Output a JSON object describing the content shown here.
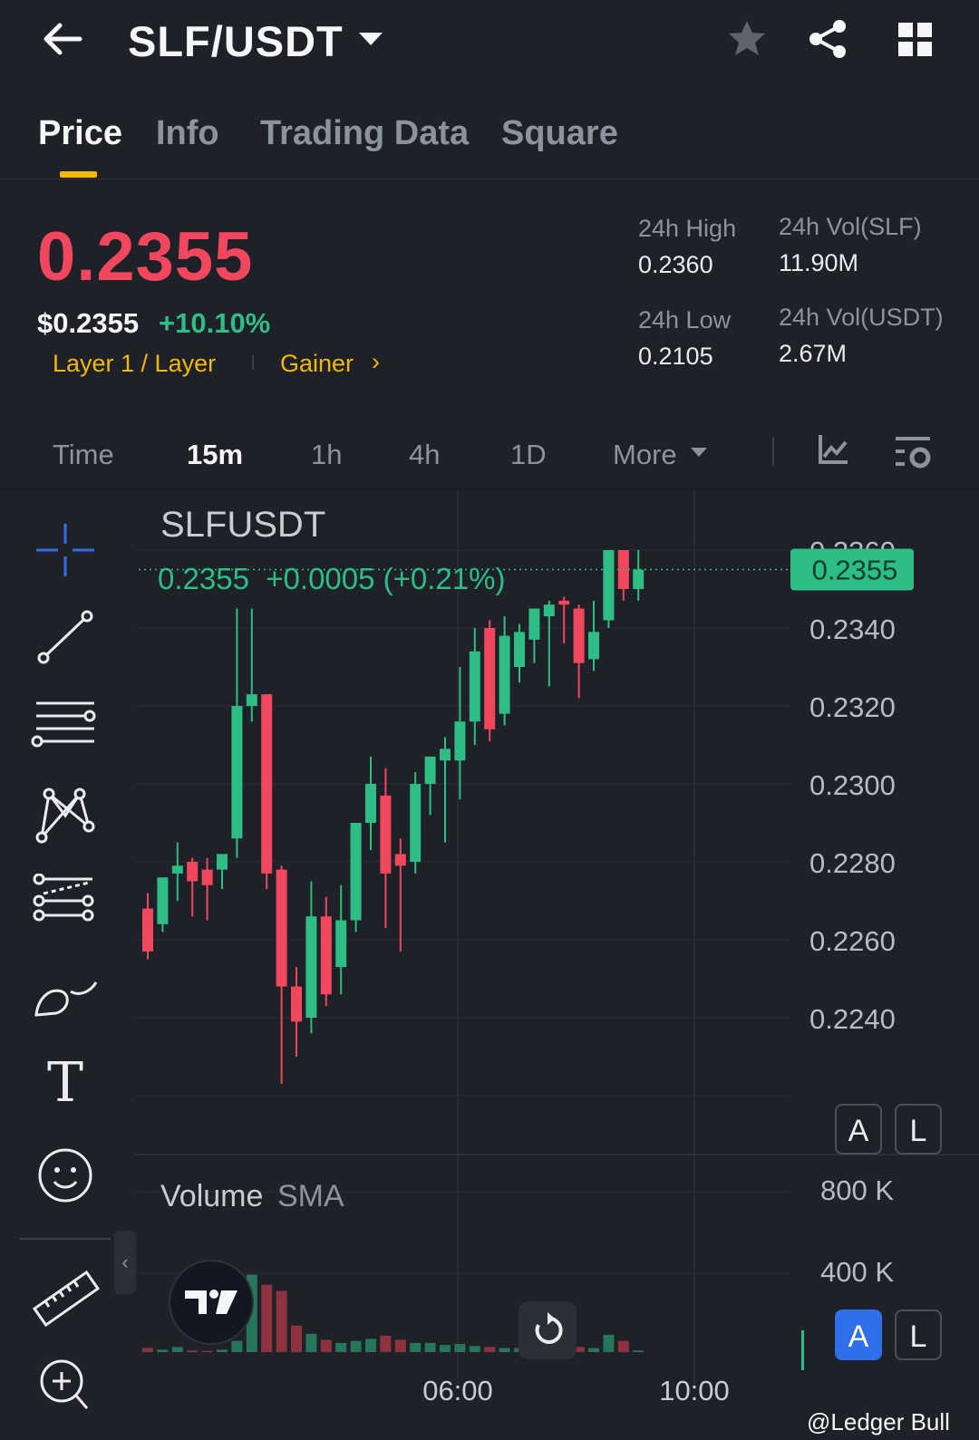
{
  "header": {
    "pair": "SLF/USDT",
    "icons": [
      "back-arrow-icon",
      "caret-down-icon",
      "star-icon",
      "share-icon",
      "grid-icon"
    ]
  },
  "tabs": [
    {
      "label": "Price",
      "active": true
    },
    {
      "label": "Info",
      "active": false
    },
    {
      "label": "Trading Data",
      "active": false
    },
    {
      "label": "Square",
      "active": false
    }
  ],
  "ticker": {
    "last_price": "0.2355",
    "usd_price": "$0.2355",
    "change_pct": "+10.10%",
    "tag_layer": "Layer 1 / Layer",
    "tag_gainer": "Gainer",
    "chevron": "›",
    "high_label": "24h High",
    "high_value": "0.2360",
    "low_label": "24h Low",
    "low_value": "0.2105",
    "vol_slf_label": "24h Vol(SLF)",
    "vol_slf_value": "11.90M",
    "vol_usdt_label": "24h Vol(USDT)",
    "vol_usdt_value": "2.67M",
    "colors": {
      "down": "#f0475e",
      "up": "#2ebd85",
      "accent": "#f0b90b"
    }
  },
  "intervals": {
    "items": [
      "Time",
      "15m",
      "1h",
      "4h",
      "1D",
      "More"
    ],
    "active": "15m"
  },
  "toolbar": {
    "tools": [
      "crosshair-icon",
      "trend-line-icon",
      "horizontal-lines-icon",
      "pattern-icon",
      "fib-lines-icon",
      "brush-icon",
      "text-icon",
      "emoji-icon",
      "ruler-icon",
      "zoom-in-icon"
    ],
    "text_tool_glyph": "T",
    "collapse_glyph": "‹"
  },
  "chart": {
    "symbol": "SLFUSDT",
    "quote_line": "0.2355  +0.0005 (+0.21%)",
    "price_tag": "0.2355",
    "price_axis": [
      "0.2360",
      "0.2340",
      "0.2320",
      "0.2300",
      "0.2280",
      "0.2260",
      "0.2240"
    ],
    "volume_label": "Volume",
    "volume_sma_label": "SMA",
    "volume_axis": [
      "800 K",
      "400 K"
    ],
    "time_axis": [
      "06:00",
      "10:00"
    ],
    "auto_btn": "A",
    "log_btn": "L",
    "watermark": "@Ledger Bull"
  },
  "chart_data": {
    "type": "candlestick",
    "title": "SLFUSDT",
    "ylim": [
      0.2225,
      0.2365
    ],
    "x_ticks": [
      "06:00",
      "10:00"
    ],
    "candles": [
      {
        "o": 0.2268,
        "h": 0.2272,
        "l": 0.2255,
        "c": 0.2257
      },
      {
        "o": 0.2264,
        "h": 0.2276,
        "l": 0.2262,
        "c": 0.2276
      },
      {
        "o": 0.2277,
        "h": 0.2285,
        "l": 0.227,
        "c": 0.2279
      },
      {
        "o": 0.228,
        "h": 0.2281,
        "l": 0.2266,
        "c": 0.2275
      },
      {
        "o": 0.2278,
        "h": 0.2281,
        "l": 0.2265,
        "c": 0.2274
      },
      {
        "o": 0.2278,
        "h": 0.2282,
        "l": 0.2273,
        "c": 0.2282
      },
      {
        "o": 0.2286,
        "h": 0.2345,
        "l": 0.2281,
        "c": 0.232
      },
      {
        "o": 0.232,
        "h": 0.2345,
        "l": 0.2316,
        "c": 0.2323
      },
      {
        "o": 0.2323,
        "h": 0.2315,
        "l": 0.2273,
        "c": 0.2277
      },
      {
        "o": 0.2278,
        "h": 0.2279,
        "l": 0.2223,
        "c": 0.2248
      },
      {
        "o": 0.2248,
        "h": 0.2253,
        "l": 0.223,
        "c": 0.2239
      },
      {
        "o": 0.224,
        "h": 0.2275,
        "l": 0.2236,
        "c": 0.2266
      },
      {
        "o": 0.2266,
        "h": 0.2271,
        "l": 0.2243,
        "c": 0.2246
      },
      {
        "o": 0.2253,
        "h": 0.2274,
        "l": 0.2246,
        "c": 0.2265
      },
      {
        "o": 0.2265,
        "h": 0.2287,
        "l": 0.2262,
        "c": 0.229
      },
      {
        "o": 0.229,
        "h": 0.2307,
        "l": 0.2283,
        "c": 0.23
      },
      {
        "o": 0.2297,
        "h": 0.2304,
        "l": 0.2263,
        "c": 0.2277
      },
      {
        "o": 0.2282,
        "h": 0.2286,
        "l": 0.2257,
        "c": 0.2279
      },
      {
        "o": 0.228,
        "h": 0.2303,
        "l": 0.2277,
        "c": 0.23
      },
      {
        "o": 0.23,
        "h": 0.2304,
        "l": 0.2292,
        "c": 0.2307
      },
      {
        "o": 0.2306,
        "h": 0.2312,
        "l": 0.2285,
        "c": 0.2309
      },
      {
        "o": 0.2306,
        "h": 0.233,
        "l": 0.2296,
        "c": 0.2316
      },
      {
        "o": 0.2316,
        "h": 0.234,
        "l": 0.231,
        "c": 0.2334
      },
      {
        "o": 0.234,
        "h": 0.2342,
        "l": 0.2311,
        "c": 0.2314
      },
      {
        "o": 0.2318,
        "h": 0.2343,
        "l": 0.2315,
        "c": 0.2338
      },
      {
        "o": 0.233,
        "h": 0.2341,
        "l": 0.2326,
        "c": 0.2339
      },
      {
        "o": 0.2337,
        "h": 0.2345,
        "l": 0.2331,
        "c": 0.2345
      },
      {
        "o": 0.2343,
        "h": 0.2347,
        "l": 0.2325,
        "c": 0.2346
      },
      {
        "o": 0.2347,
        "h": 0.2348,
        "l": 0.2336,
        "c": 0.2346
      },
      {
        "o": 0.2345,
        "h": 0.2346,
        "l": 0.2322,
        "c": 0.2331
      },
      {
        "o": 0.2332,
        "h": 0.2347,
        "l": 0.2329,
        "c": 0.2339
      },
      {
        "o": 0.2342,
        "h": 0.236,
        "l": 0.234,
        "c": 0.236
      },
      {
        "o": 0.236,
        "h": 0.236,
        "l": 0.2347,
        "c": 0.235
      },
      {
        "o": 0.235,
        "h": 0.236,
        "l": 0.2347,
        "c": 0.2355
      }
    ],
    "volume": [
      20,
      12,
      25,
      8,
      6,
      12,
      55,
      380,
      330,
      300,
      130,
      90,
      60,
      45,
      55,
      65,
      80,
      60,
      45,
      45,
      35,
      40,
      30,
      25,
      20,
      20,
      20,
      15,
      30,
      25,
      20,
      85,
      55,
      8
    ],
    "volume_axis": [
      "800 K",
      "400 K"
    ],
    "colors": {
      "up": "#2ebd85",
      "down": "#f0475e",
      "vol_up": "#25765a",
      "vol_down": "#8f3240"
    }
  }
}
